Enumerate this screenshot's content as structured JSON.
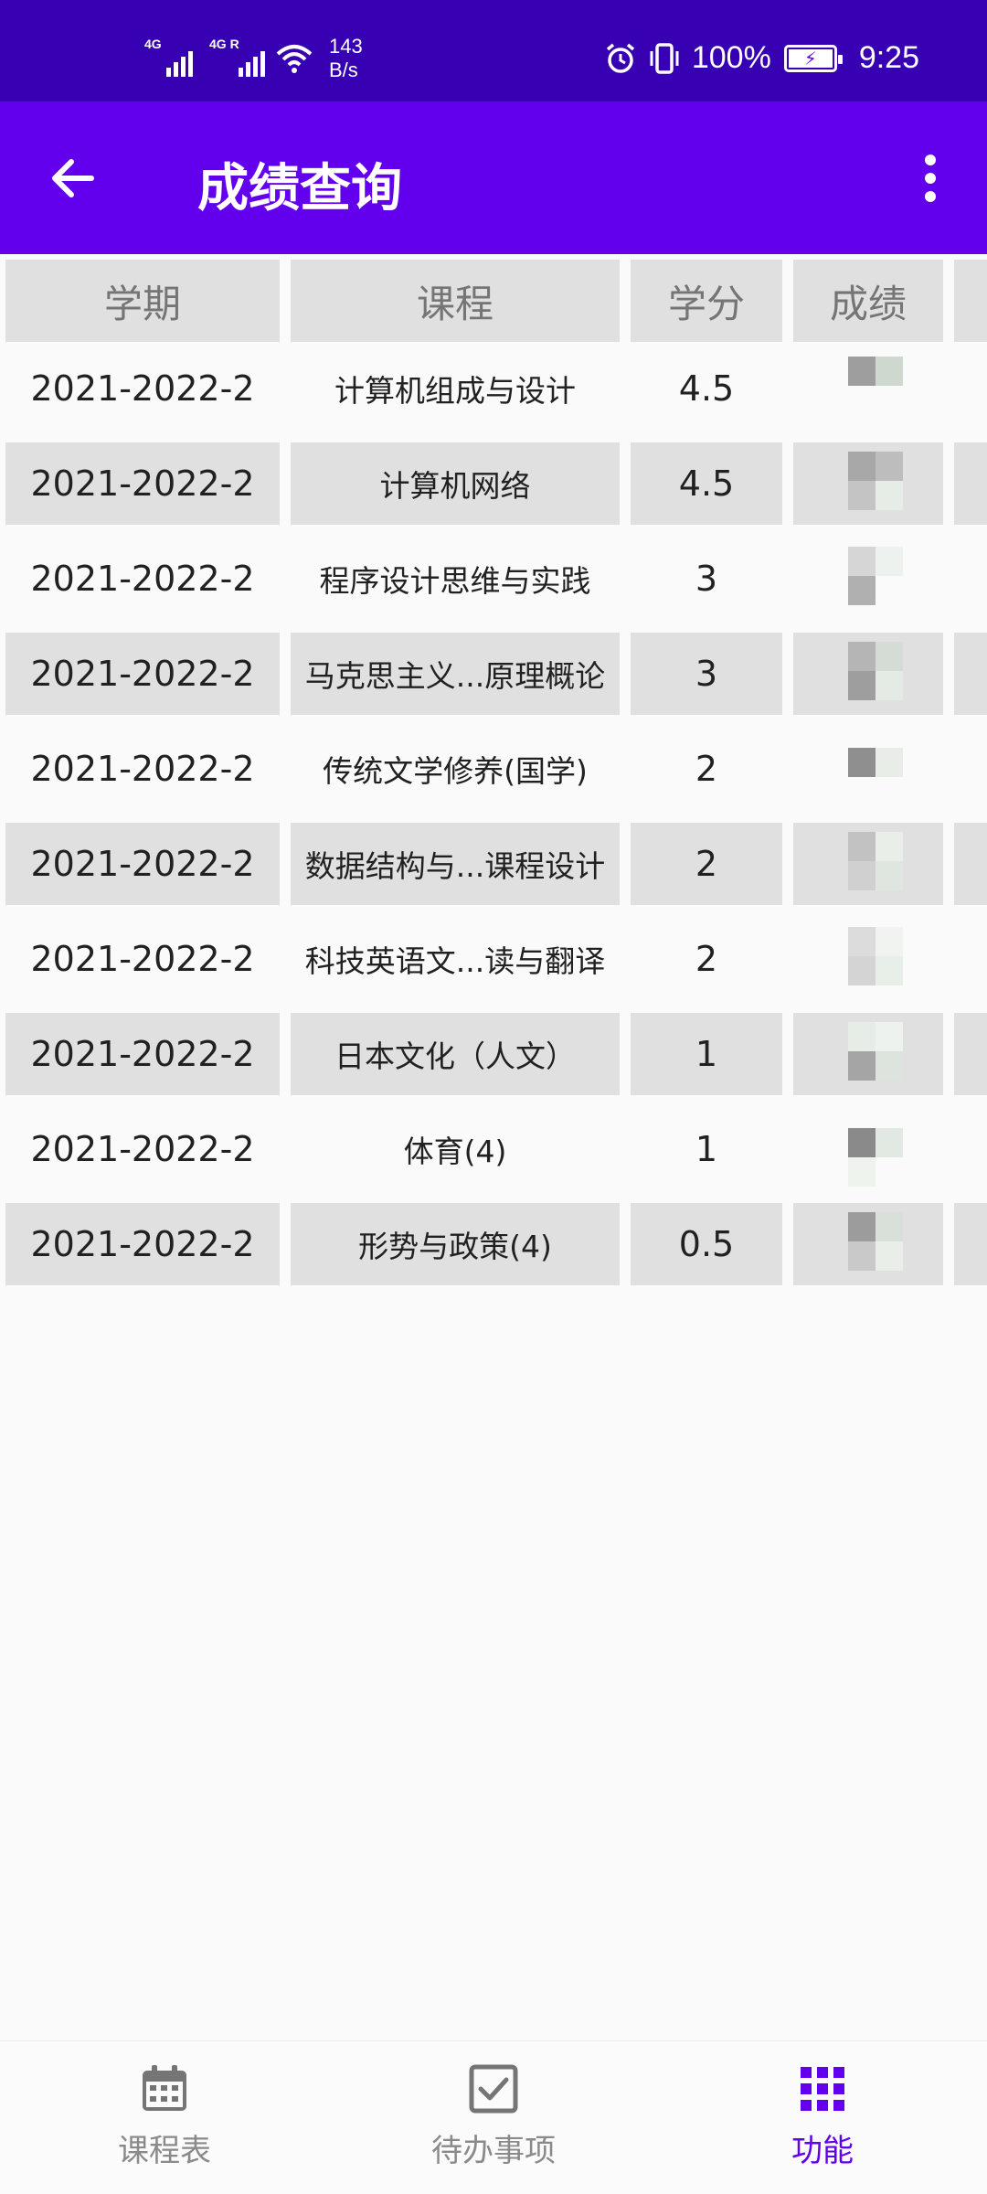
{
  "status_bar": {
    "sim1": "4G",
    "sim2": "4G R",
    "net_speed_value": "143",
    "net_speed_unit": "B/s",
    "battery": "100%",
    "time": "9:25",
    "icons": [
      "signal-icon",
      "signal-icon",
      "wifi-icon",
      "alarm-icon",
      "vibrate-icon",
      "battery-charging-icon"
    ]
  },
  "app_bar": {
    "title": "成绩查询",
    "back_icon": "arrow-left-icon",
    "more_icon": "more-vert-icon"
  },
  "table": {
    "headers": {
      "term": "学期",
      "course": "课程",
      "credit": "学分",
      "grade": "成绩"
    },
    "rows": [
      {
        "term": "2021-2022-2",
        "course": "计算机组成与设计",
        "credit": "4.5"
      },
      {
        "term": "2021-2022-2",
        "course": "计算机网络",
        "credit": "4.5"
      },
      {
        "term": "2021-2022-2",
        "course": "程序设计思维与实践",
        "credit": "3"
      },
      {
        "term": "2021-2022-2",
        "course": "马克思主义...原理概论",
        "credit": "3"
      },
      {
        "term": "2021-2022-2",
        "course": "传统文学修养(国学)",
        "credit": "2"
      },
      {
        "term": "2021-2022-2",
        "course": "数据结构与...课程设计",
        "credit": "2"
      },
      {
        "term": "2021-2022-2",
        "course": "科技英语文...读与翻译",
        "credit": "2"
      },
      {
        "term": "2021-2022-2",
        "course": "日本文化（人文）",
        "credit": "1"
      },
      {
        "term": "2021-2022-2",
        "course": "体育(4)",
        "credit": "1"
      },
      {
        "term": "2021-2022-2",
        "course": "形势与政策(4)",
        "credit": "0.5"
      }
    ]
  },
  "bottom_nav": {
    "items": [
      {
        "label": "课程表",
        "icon": "calendar-icon"
      },
      {
        "label": "待办事项",
        "icon": "checkbox-icon"
      },
      {
        "label": "功能",
        "icon": "grid-icon"
      }
    ],
    "active_index": 2
  },
  "colors": {
    "status_bar": "#3700b3",
    "app_bar": "#6200ee",
    "accent": "#6200ee",
    "row_shade": "#e0e0e0"
  }
}
